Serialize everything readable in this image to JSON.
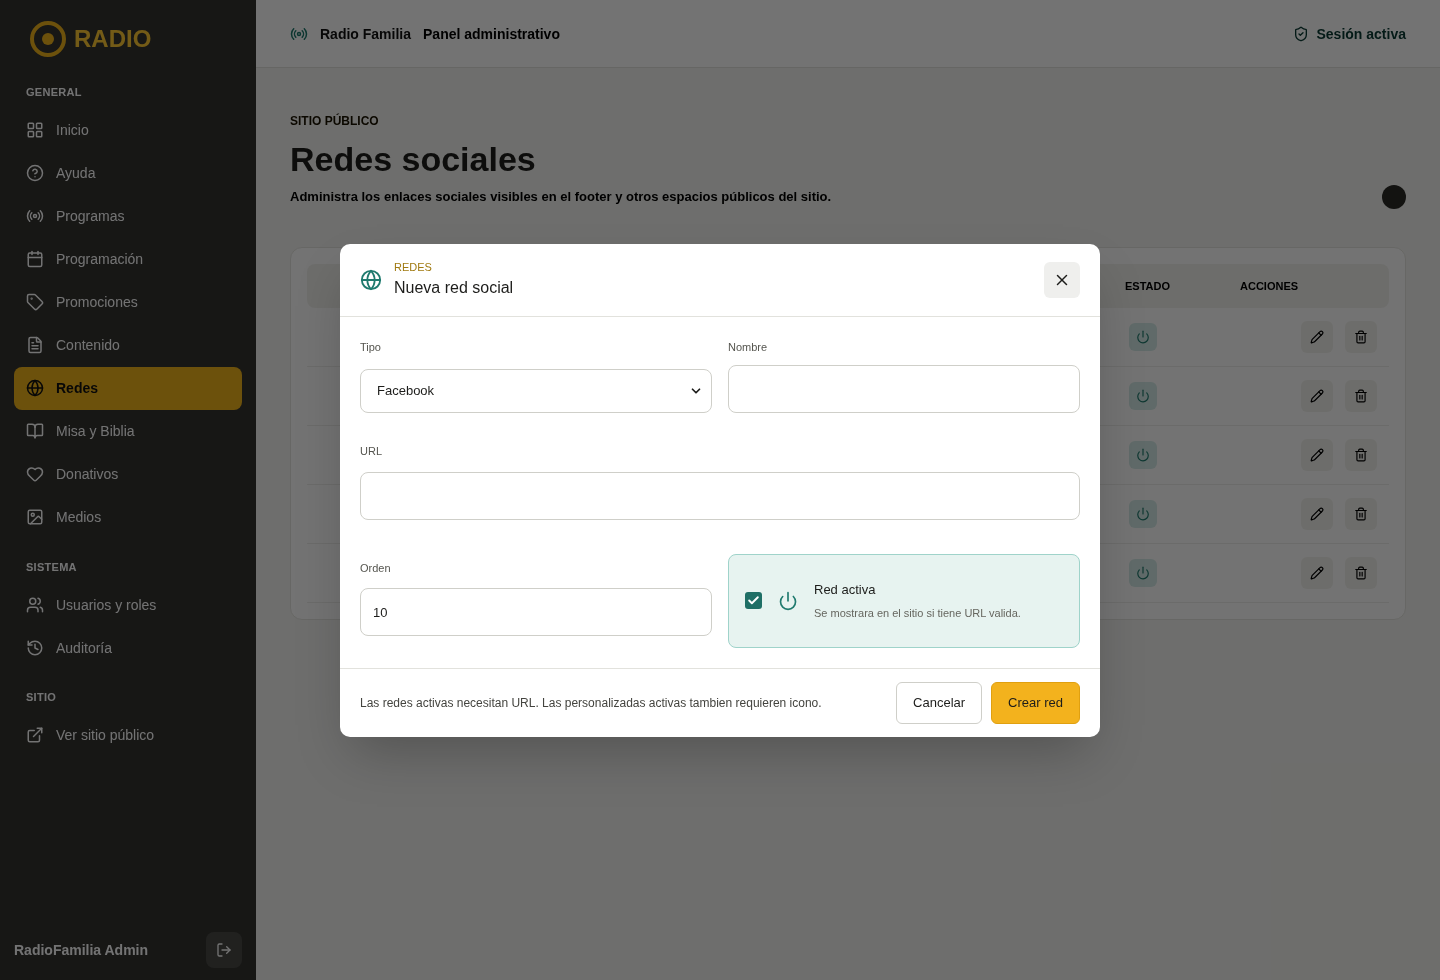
{
  "sidebar": {
    "logo_text": "RADIO",
    "sections": [
      {
        "title": "GENERAL",
        "items": [
          {
            "label": "Inicio",
            "selected": false
          },
          {
            "label": "Ayuda",
            "selected": false
          },
          {
            "label": "Programas",
            "selected": false
          },
          {
            "label": "Programación",
            "selected": false
          },
          {
            "label": "Promociones",
            "selected": false
          },
          {
            "label": "Contenido",
            "selected": false
          },
          {
            "label": "Redes",
            "selected": true
          },
          {
            "label": "Misa y Biblia",
            "selected": false
          },
          {
            "label": "Donativos",
            "selected": false
          },
          {
            "label": "Medios",
            "selected": false
          }
        ]
      },
      {
        "title": "SISTEMA",
        "items": [
          {
            "label": "Usuarios y roles",
            "selected": false
          },
          {
            "label": "Auditoría",
            "selected": false
          }
        ]
      },
      {
        "title": "SITIO",
        "items": [
          {
            "label": "Ver sitio público",
            "selected": false
          }
        ]
      }
    ],
    "user": {
      "name": "RadioFamilia Admin"
    }
  },
  "topbar": {
    "breadcrumb": [
      "Radio Familia",
      "Panel administrativo"
    ],
    "session": "Sesión activa"
  },
  "page": {
    "eyebrow": "SITIO PÚBLICO",
    "title": "Redes sociales",
    "description": "Administra los enlaces sociales visibles en el footer y otros espacios públicos del sitio."
  },
  "table": {
    "columns": [
      "ESTADO",
      "ACCIONES"
    ],
    "rows": [
      {
        "active": true
      },
      {
        "active": true
      },
      {
        "active": true
      },
      {
        "active": true
      },
      {
        "active": true
      }
    ]
  },
  "modal": {
    "eyebrow": "REDES",
    "title": "Nueva red social",
    "tipo": {
      "label": "Tipo",
      "value": "Facebook"
    },
    "nombre": {
      "label": "Nombre"
    },
    "url": {
      "label": "URL"
    },
    "orden": {
      "label": "Orden",
      "value": "10"
    },
    "active_card": {
      "checked": true,
      "title": "Red activa",
      "description": "Se mostrara en el sitio si tiene URL valida."
    },
    "note": "Las redes activas necesitan URL. Las personalizadas activas tambien requieren icono.",
    "buttons": [
      {
        "label": "Cancelar",
        "kind": "secondary"
      },
      {
        "label": "Crear red",
        "kind": "primary"
      }
    ]
  }
}
